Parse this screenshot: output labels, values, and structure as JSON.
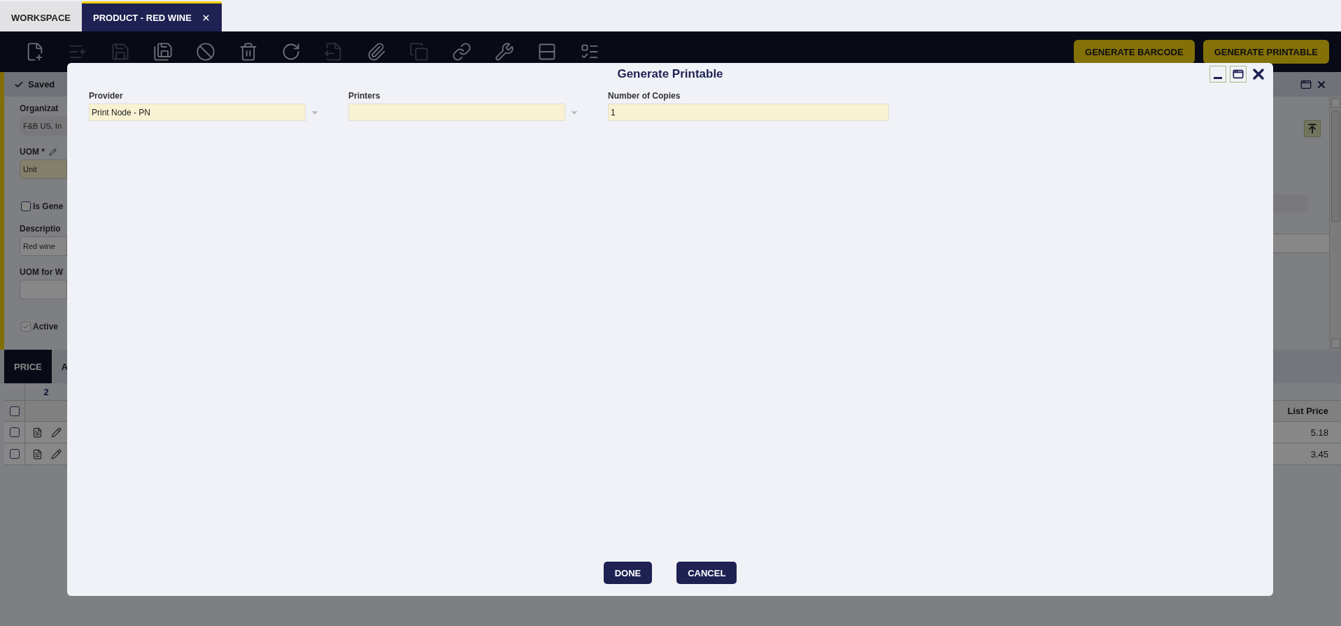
{
  "tabs": [
    {
      "label": "WORKSPACE",
      "selected": false,
      "closable": false
    },
    {
      "label": "PRODUCT - RED WINE",
      "selected": true,
      "closable": true
    }
  ],
  "toolbar": {
    "tools": [
      {
        "disabled": false
      },
      {
        "disabled": true
      },
      {
        "disabled": true
      },
      {
        "disabled": false
      },
      {
        "disabled": false
      },
      {
        "disabled": false
      },
      {
        "disabled": false
      },
      {
        "disabled": true
      },
      {
        "disabled": false
      },
      {
        "disabled": true
      },
      {
        "disabled": false
      },
      {
        "disabled": false
      },
      {
        "disabled": false
      },
      {
        "disabled": false
      }
    ],
    "actions": [
      "GENERATE BARCODE",
      "GENERATE PRINTABLE"
    ]
  },
  "record": {
    "status": "Saved",
    "fields": [
      {
        "kind": "text",
        "label": "Organizat",
        "value": "F&B US, In",
        "readonly": true,
        "required": false,
        "link": false
      },
      {
        "kind": "text",
        "label": "UOM *",
        "value": "Unit",
        "readonly": false,
        "required": true,
        "link": true
      },
      {
        "kind": "checkbox",
        "label": "Is Gene",
        "checked": false
      },
      {
        "kind": "text",
        "label": "Descriptio",
        "value": "Red wine",
        "readonly": false,
        "required": false,
        "link": false
      },
      {
        "kind": "text",
        "label": "UOM for W",
        "readonly": false,
        "required": false,
        "link": false
      },
      {
        "kind": "checkbox",
        "label": "Active",
        "checked": true
      }
    ]
  },
  "detail_tabs": [
    {
      "label": "PRICE",
      "selected": true
    },
    {
      "label": "A",
      "selected": false
    }
  ],
  "grid": {
    "count": "2",
    "all_checked": false,
    "columns": [
      "List Price"
    ],
    "rows": [
      {
        "checked": false,
        "list_price": "5.18"
      },
      {
        "checked": false,
        "list_price": "3.45"
      }
    ]
  },
  "dialog": {
    "title": "Generate Printable",
    "fields": [
      {
        "kind": "select",
        "label": "Provider",
        "value": "Print Node - PN"
      },
      {
        "kind": "select",
        "label": "Printers"
      },
      {
        "kind": "text",
        "label": "Number of Copies",
        "value": "1"
      }
    ],
    "buttons": [
      "DONE",
      "CANCEL"
    ]
  }
}
